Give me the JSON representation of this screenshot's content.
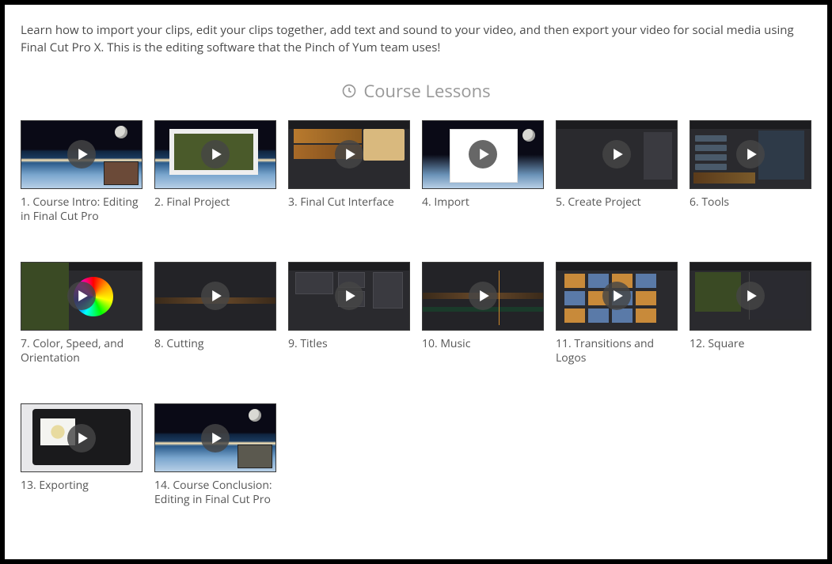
{
  "intro_text": "Learn how to import your clips, edit your clips together, add text and sound to your video, and then export your video for social media using Final Cut Pro X. This is the editing software that the Pinch of Yum team uses!",
  "section_title": "Course Lessons",
  "lessons": [
    {
      "title": "1. Course Intro: Editing in Final Cut Pro"
    },
    {
      "title": "2. Final Project"
    },
    {
      "title": "3. Final Cut Interface"
    },
    {
      "title": "4. Import"
    },
    {
      "title": "5. Create Project"
    },
    {
      "title": "6. Tools"
    },
    {
      "title": "7. Color, Speed, and Orientation"
    },
    {
      "title": "8. Cutting"
    },
    {
      "title": "9. Titles"
    },
    {
      "title": "10. Music"
    },
    {
      "title": "11. Transitions and Logos"
    },
    {
      "title": "12. Square"
    },
    {
      "title": "13. Exporting"
    },
    {
      "title": "14. Course Conclusion: Editing in Final Cut Pro"
    }
  ]
}
